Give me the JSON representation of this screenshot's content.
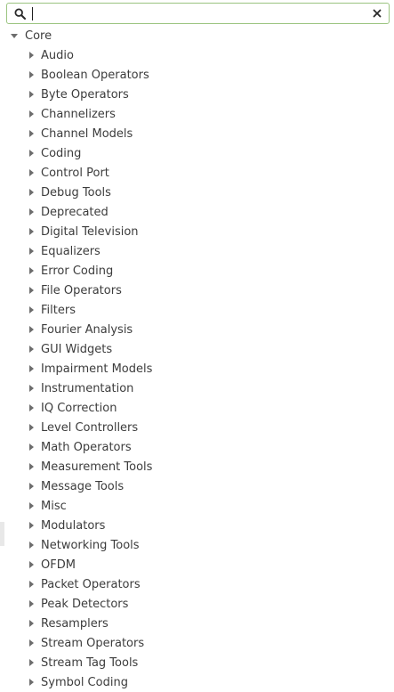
{
  "search": {
    "value": "",
    "placeholder": ""
  },
  "tree": {
    "root_label": "Core",
    "items": [
      {
        "label": "Audio"
      },
      {
        "label": "Boolean Operators"
      },
      {
        "label": "Byte Operators"
      },
      {
        "label": "Channelizers"
      },
      {
        "label": "Channel Models"
      },
      {
        "label": "Coding"
      },
      {
        "label": "Control Port"
      },
      {
        "label": "Debug Tools"
      },
      {
        "label": "Deprecated"
      },
      {
        "label": "Digital Television"
      },
      {
        "label": "Equalizers"
      },
      {
        "label": "Error Coding"
      },
      {
        "label": "File Operators"
      },
      {
        "label": "Filters"
      },
      {
        "label": "Fourier Analysis"
      },
      {
        "label": "GUI Widgets"
      },
      {
        "label": "Impairment Models"
      },
      {
        "label": "Instrumentation"
      },
      {
        "label": "IQ Correction"
      },
      {
        "label": "Level Controllers"
      },
      {
        "label": "Math Operators"
      },
      {
        "label": "Measurement Tools"
      },
      {
        "label": "Message Tools"
      },
      {
        "label": "Misc"
      },
      {
        "label": "Modulators"
      },
      {
        "label": "Networking Tools"
      },
      {
        "label": "OFDM"
      },
      {
        "label": "Packet Operators"
      },
      {
        "label": "Peak Detectors"
      },
      {
        "label": "Resamplers"
      },
      {
        "label": "Stream Operators"
      },
      {
        "label": "Stream Tag Tools"
      },
      {
        "label": "Symbol Coding"
      }
    ]
  },
  "icons": {
    "search": "search-icon",
    "clear": "close-icon",
    "expanded": "triangle-down-icon",
    "collapsed": "triangle-right-icon"
  },
  "colors": {
    "focus_border": "#9bc480",
    "text": "#3c3c3c",
    "arrow": "#6d6d6d"
  }
}
